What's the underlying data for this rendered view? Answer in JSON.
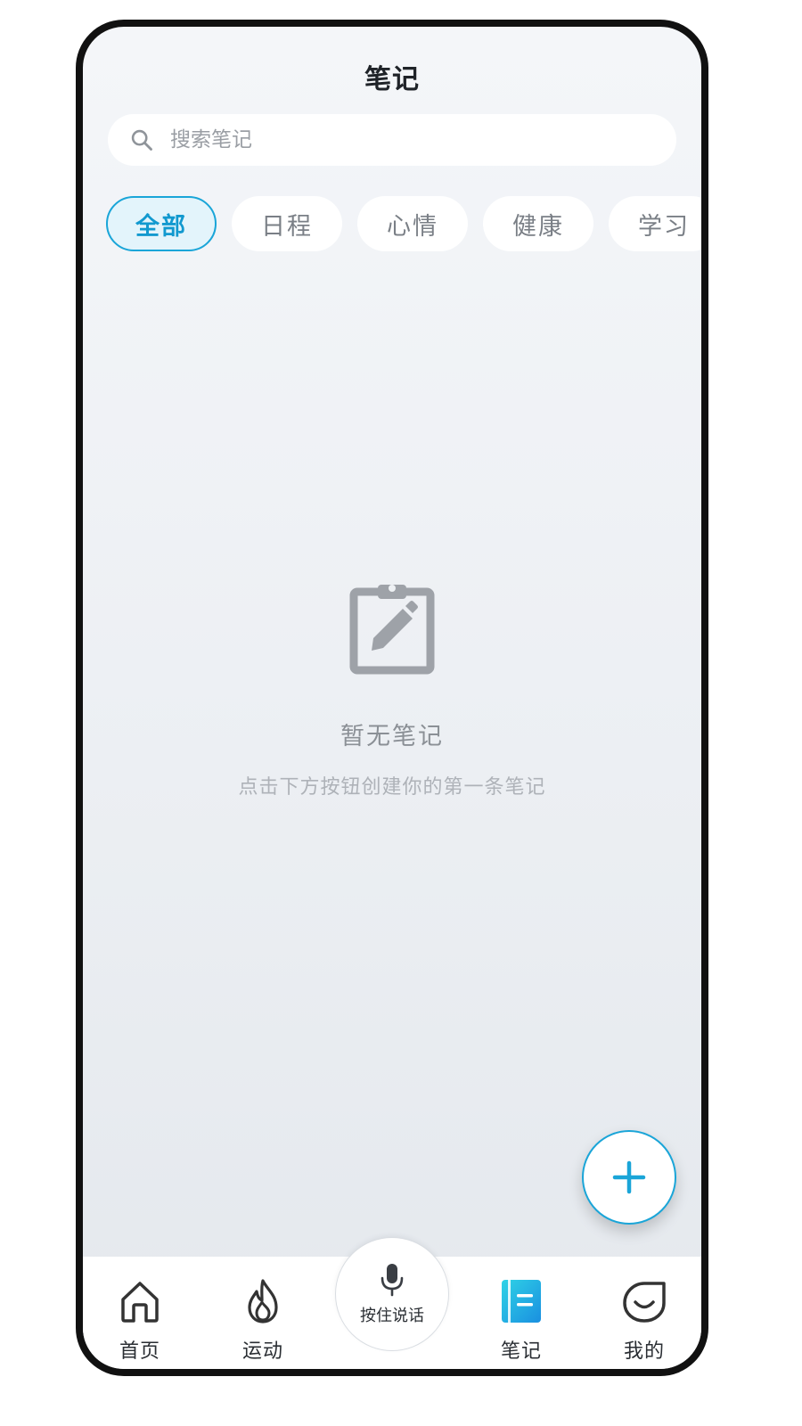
{
  "header": {
    "title": "笔记"
  },
  "search": {
    "placeholder": "搜索笔记",
    "value": ""
  },
  "categories": [
    {
      "label": "全部",
      "active": true
    },
    {
      "label": "日程",
      "active": false
    },
    {
      "label": "心情",
      "active": false
    },
    {
      "label": "健康",
      "active": false
    },
    {
      "label": "学习",
      "active": false
    }
  ],
  "empty_state": {
    "icon": "clipboard-edit-icon",
    "title": "暂无笔记",
    "subtitle": "点击下方按钮创建你的第一条笔记"
  },
  "fab": {
    "icon": "plus-icon"
  },
  "voice_button": {
    "label": "按住说话",
    "icon": "microphone-icon"
  },
  "tabbar": {
    "items": [
      {
        "label": "首页",
        "icon": "home-icon",
        "active": false
      },
      {
        "label": "运动",
        "icon": "flame-icon",
        "active": false
      },
      {
        "label": "笔记",
        "icon": "notebook-icon",
        "active": true
      },
      {
        "label": "我的",
        "icon": "smile-face-icon",
        "active": false
      }
    ]
  },
  "colors": {
    "accent": "#1aa5d8",
    "accent_text": "#1299cf",
    "chip_active_bg": "#e3f4fb",
    "muted_text": "#8b9096",
    "icon_gray": "#9ea2a8"
  }
}
